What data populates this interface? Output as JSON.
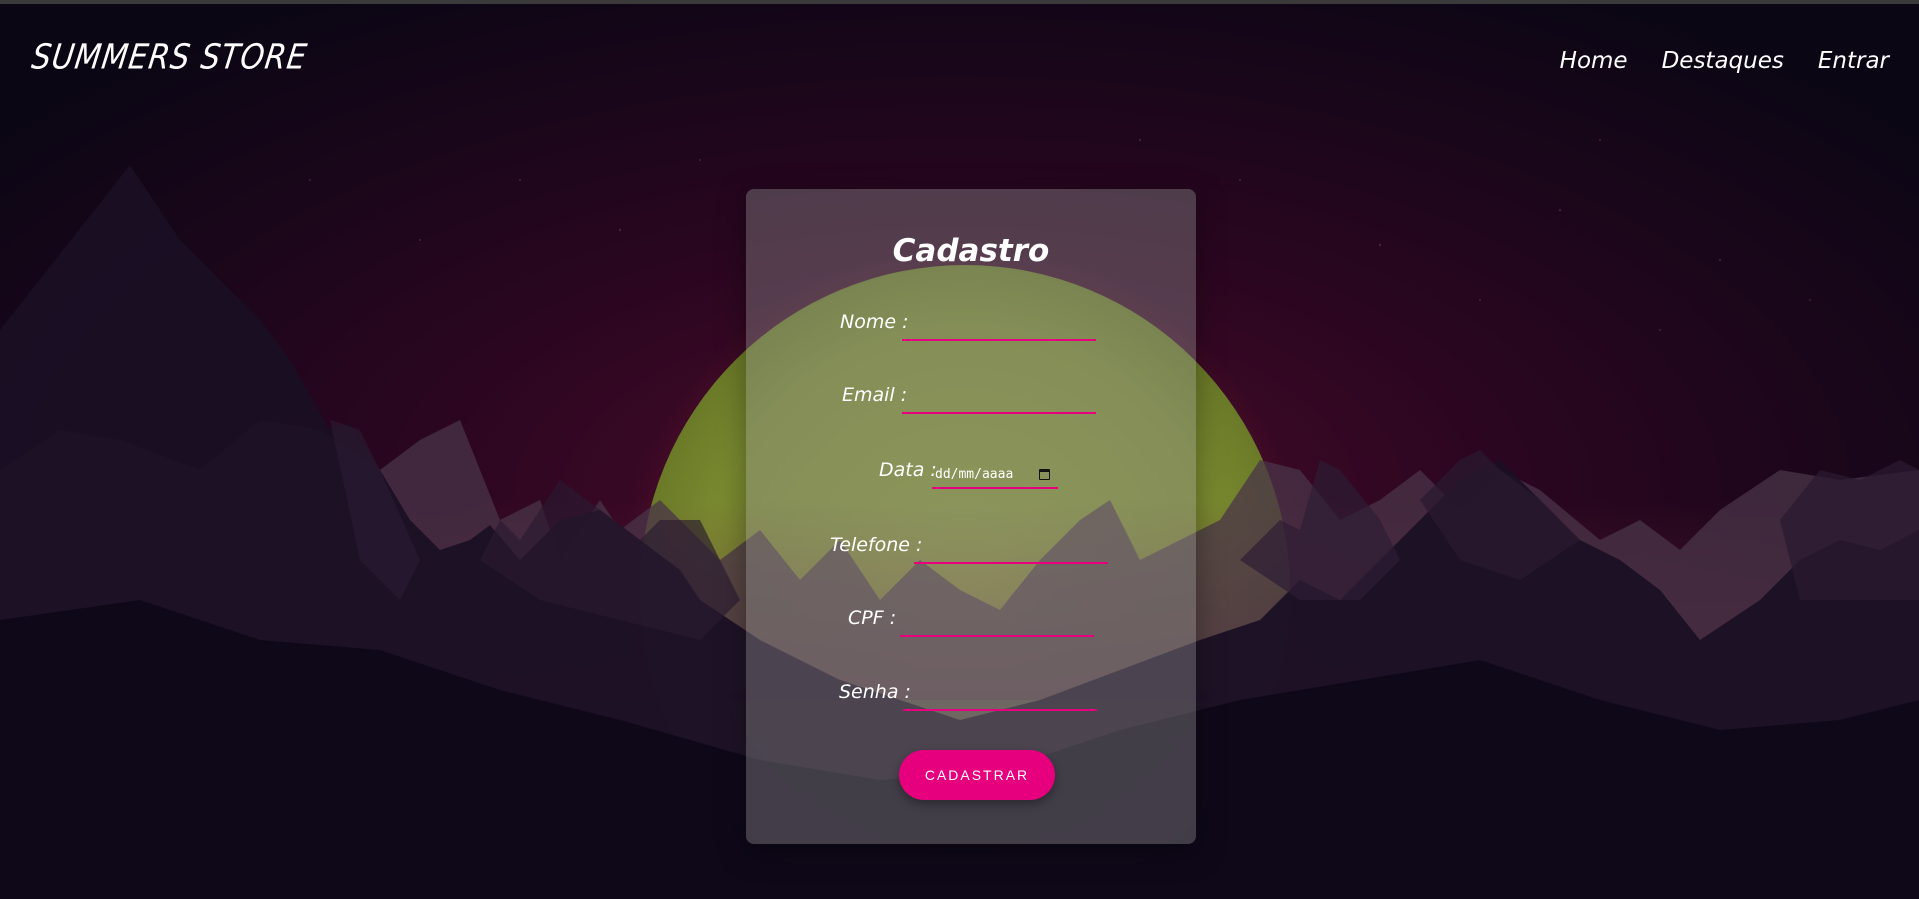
{
  "navbar": {
    "brand": "SUMMERS STORE",
    "links": [
      "Home",
      "Destaques",
      "Entrar"
    ]
  },
  "form": {
    "title": "Cadastro",
    "fields": {
      "nome": {
        "label": "Nome :",
        "value": ""
      },
      "email": {
        "label": "Email :",
        "value": ""
      },
      "data": {
        "label": "Data :",
        "placeholder": "dd/mm/aaaa"
      },
      "telefone": {
        "label": "Telefone :",
        "value": ""
      },
      "cpf": {
        "label": "CPF :",
        "value": ""
      },
      "senha": {
        "label": "Senha :",
        "value": ""
      }
    },
    "submit_label": "CADASTRAR"
  },
  "colors": {
    "accent": "#e6007e",
    "sun": "#8a9a3a",
    "sky_glow": "#4a0a2a",
    "background": "#07050f"
  }
}
